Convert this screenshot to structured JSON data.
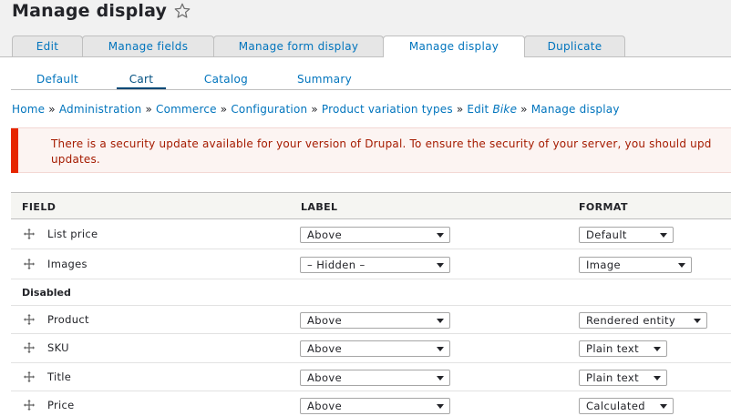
{
  "page": {
    "title": "Manage display",
    "star_icon": "star-outline-icon"
  },
  "tabs": [
    {
      "label": "Edit",
      "active": false
    },
    {
      "label": "Manage fields",
      "active": false
    },
    {
      "label": "Manage form display",
      "active": false
    },
    {
      "label": "Manage display",
      "active": true
    },
    {
      "label": "Duplicate",
      "active": false
    }
  ],
  "subtabs": [
    {
      "label": "Default",
      "active": false
    },
    {
      "label": "Cart",
      "active": true
    },
    {
      "label": "Catalog",
      "active": false
    },
    {
      "label": "Summary",
      "active": false
    }
  ],
  "breadcrumb": {
    "items": [
      "Home",
      "Administration",
      "Commerce",
      "Configuration",
      "Product variation types",
      "Edit",
      "Bike",
      "Manage display"
    ],
    "separator": "»"
  },
  "message": {
    "text_line1": "There is a security update available for your version of Drupal. To ensure the security of your server, you should upd",
    "text_line2": "updates."
  },
  "table": {
    "headers": {
      "field": "FIELD",
      "label": "LABEL",
      "format": "FORMAT"
    },
    "region_disabled": "Disabled",
    "rows": [
      {
        "field": "List price",
        "label": "Above",
        "format": "Default"
      },
      {
        "field": "Images",
        "label": "– Hidden –",
        "format": "Image"
      },
      {
        "field": "Product",
        "label": "Above",
        "format": "Rendered entity"
      },
      {
        "field": "SKU",
        "label": "Above",
        "format": "Plain text"
      },
      {
        "field": "Title",
        "label": "Above",
        "format": "Plain text"
      },
      {
        "field": "Price",
        "label": "Above",
        "format": "Calculated"
      }
    ]
  },
  "colors": {
    "link": "#0074bd",
    "error_bar": "#e62600",
    "error_text": "#a51b00",
    "error_bg": "#fcf4f2"
  }
}
